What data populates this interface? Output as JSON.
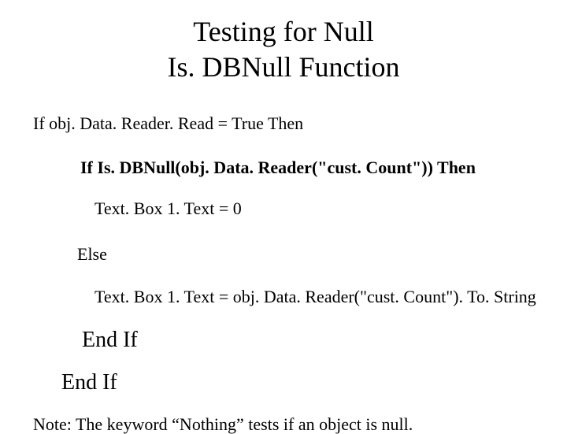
{
  "title": {
    "line1": "Testing for Null",
    "line2": "Is. DBNull  Function"
  },
  "code": {
    "outer_if": "If obj. Data. Reader. Read = True Then",
    "inner_if": "If Is. DBNull(obj. Data. Reader(\"cust. Count\")) Then",
    "assign1": "Text. Box 1. Text = 0",
    "else": "Else",
    "assign2": "Text. Box 1. Text = obj. Data. Reader(\"cust. Count\"). To. String",
    "endif_inner": "End If",
    "endif_outer": "End If"
  },
  "note": "Note: The keyword “Nothing” tests if an object is null."
}
